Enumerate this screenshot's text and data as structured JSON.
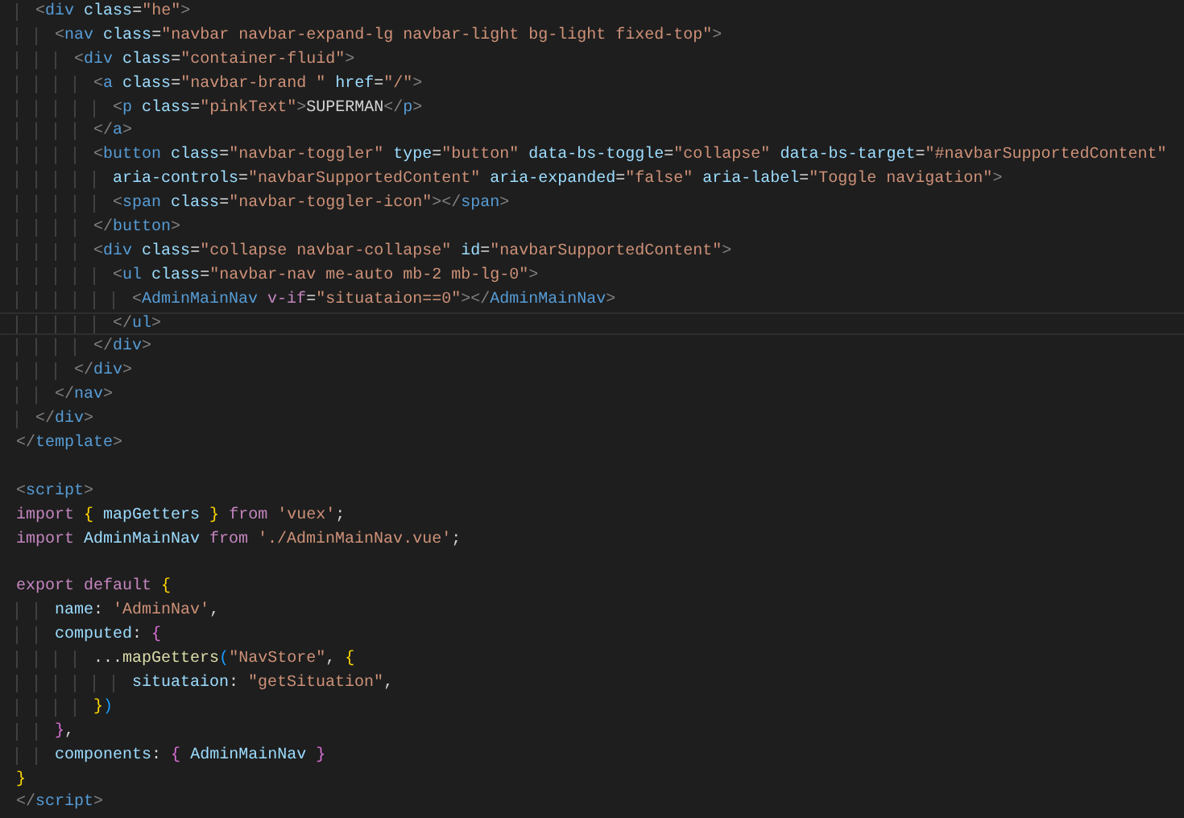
{
  "editor": {
    "lines": [
      {
        "current": false,
        "tokens": [
          {
            "kind": "punct",
            "text": "  <"
          },
          {
            "kind": "tag",
            "text": "div"
          },
          {
            "kind": "attr",
            "text": " class"
          },
          {
            "kind": "text",
            "text": "="
          },
          {
            "kind": "str",
            "text": "\"he\""
          },
          {
            "kind": "punct",
            "text": ">"
          }
        ]
      },
      {
        "current": false,
        "tokens": [
          {
            "kind": "punct",
            "text": "    <"
          },
          {
            "kind": "tag",
            "text": "nav"
          },
          {
            "kind": "attr",
            "text": " class"
          },
          {
            "kind": "text",
            "text": "="
          },
          {
            "kind": "str",
            "text": "\"navbar navbar-expand-lg navbar-light bg-light fixed-top\""
          },
          {
            "kind": "punct",
            "text": ">"
          }
        ]
      },
      {
        "current": false,
        "tokens": [
          {
            "kind": "punct",
            "text": "      <"
          },
          {
            "kind": "tag",
            "text": "div"
          },
          {
            "kind": "attr",
            "text": " class"
          },
          {
            "kind": "text",
            "text": "="
          },
          {
            "kind": "str",
            "text": "\"container-fluid\""
          },
          {
            "kind": "punct",
            "text": ">"
          }
        ]
      },
      {
        "current": false,
        "tokens": [
          {
            "kind": "punct",
            "text": "        <"
          },
          {
            "kind": "tag",
            "text": "a"
          },
          {
            "kind": "attr",
            "text": " class"
          },
          {
            "kind": "text",
            "text": "="
          },
          {
            "kind": "str",
            "text": "\"navbar-brand \""
          },
          {
            "kind": "attr",
            "text": " href"
          },
          {
            "kind": "text",
            "text": "="
          },
          {
            "kind": "str",
            "text": "\"/\""
          },
          {
            "kind": "punct",
            "text": ">"
          }
        ]
      },
      {
        "current": false,
        "tokens": [
          {
            "kind": "punct",
            "text": "          <"
          },
          {
            "kind": "tag",
            "text": "p"
          },
          {
            "kind": "attr",
            "text": " class"
          },
          {
            "kind": "text",
            "text": "="
          },
          {
            "kind": "str",
            "text": "\"pinkText\""
          },
          {
            "kind": "punct",
            "text": ">"
          },
          {
            "kind": "text",
            "text": "SUPERMAN"
          },
          {
            "kind": "punct",
            "text": "</"
          },
          {
            "kind": "tag",
            "text": "p"
          },
          {
            "kind": "punct",
            "text": ">"
          }
        ]
      },
      {
        "current": false,
        "tokens": [
          {
            "kind": "punct",
            "text": "        </"
          },
          {
            "kind": "tag",
            "text": "a"
          },
          {
            "kind": "punct",
            "text": ">"
          }
        ]
      },
      {
        "current": false,
        "tokens": [
          {
            "kind": "punct",
            "text": "        <"
          },
          {
            "kind": "tag",
            "text": "button"
          },
          {
            "kind": "attr",
            "text": " class"
          },
          {
            "kind": "text",
            "text": "="
          },
          {
            "kind": "str",
            "text": "\"navbar-toggler\""
          },
          {
            "kind": "attr",
            "text": " type"
          },
          {
            "kind": "text",
            "text": "="
          },
          {
            "kind": "str",
            "text": "\"button\""
          },
          {
            "kind": "attr",
            "text": " data-bs-toggle"
          },
          {
            "kind": "text",
            "text": "="
          },
          {
            "kind": "str",
            "text": "\"collapse\""
          },
          {
            "kind": "attr",
            "text": " data-bs-target"
          },
          {
            "kind": "text",
            "text": "="
          },
          {
            "kind": "str",
            "text": "\"#navbarSupportedContent\""
          }
        ]
      },
      {
        "current": false,
        "tokens": [
          {
            "kind": "attr",
            "text": "          aria-controls"
          },
          {
            "kind": "text",
            "text": "="
          },
          {
            "kind": "str",
            "text": "\"navbarSupportedContent\""
          },
          {
            "kind": "attr",
            "text": " aria-expanded"
          },
          {
            "kind": "text",
            "text": "="
          },
          {
            "kind": "str",
            "text": "\"false\""
          },
          {
            "kind": "attr",
            "text": " aria-label"
          },
          {
            "kind": "text",
            "text": "="
          },
          {
            "kind": "str",
            "text": "\"Toggle navigation\""
          },
          {
            "kind": "punct",
            "text": ">"
          }
        ]
      },
      {
        "current": false,
        "tokens": [
          {
            "kind": "punct",
            "text": "          <"
          },
          {
            "kind": "tag",
            "text": "span"
          },
          {
            "kind": "attr",
            "text": " class"
          },
          {
            "kind": "text",
            "text": "="
          },
          {
            "kind": "str",
            "text": "\"navbar-toggler-icon\""
          },
          {
            "kind": "punct",
            "text": "></"
          },
          {
            "kind": "tag",
            "text": "span"
          },
          {
            "kind": "punct",
            "text": ">"
          }
        ]
      },
      {
        "current": false,
        "tokens": [
          {
            "kind": "punct",
            "text": "        </"
          },
          {
            "kind": "tag",
            "text": "button"
          },
          {
            "kind": "punct",
            "text": ">"
          }
        ]
      },
      {
        "current": false,
        "tokens": [
          {
            "kind": "punct",
            "text": "        <"
          },
          {
            "kind": "tag",
            "text": "div"
          },
          {
            "kind": "attr",
            "text": " class"
          },
          {
            "kind": "text",
            "text": "="
          },
          {
            "kind": "str",
            "text": "\"collapse navbar-collapse\""
          },
          {
            "kind": "attr",
            "text": " id"
          },
          {
            "kind": "text",
            "text": "="
          },
          {
            "kind": "str",
            "text": "\"navbarSupportedContent\""
          },
          {
            "kind": "punct",
            "text": ">"
          }
        ]
      },
      {
        "current": false,
        "tokens": [
          {
            "kind": "punct",
            "text": "          <"
          },
          {
            "kind": "tag",
            "text": "ul"
          },
          {
            "kind": "attr",
            "text": " class"
          },
          {
            "kind": "text",
            "text": "="
          },
          {
            "kind": "str",
            "text": "\"navbar-nav me-auto mb-2 mb-lg-0\""
          },
          {
            "kind": "punct",
            "text": ">"
          }
        ]
      },
      {
        "current": false,
        "tokens": [
          {
            "kind": "punct",
            "text": "            <"
          },
          {
            "kind": "tag",
            "text": "AdminMainNav"
          },
          {
            "kind": "directive",
            "text": " v-if"
          },
          {
            "kind": "text",
            "text": "="
          },
          {
            "kind": "str",
            "text": "\"situataion==0\""
          },
          {
            "kind": "punct",
            "text": "></"
          },
          {
            "kind": "tag",
            "text": "AdminMainNav"
          },
          {
            "kind": "punct",
            "text": ">"
          }
        ]
      },
      {
        "current": true,
        "tokens": [
          {
            "kind": "punct",
            "text": "          </"
          },
          {
            "kind": "tag",
            "text": "ul"
          },
          {
            "kind": "punct",
            "text": ">"
          }
        ]
      },
      {
        "current": false,
        "tokens": [
          {
            "kind": "punct",
            "text": "        </"
          },
          {
            "kind": "tag",
            "text": "div"
          },
          {
            "kind": "punct",
            "text": ">"
          }
        ]
      },
      {
        "current": false,
        "tokens": [
          {
            "kind": "punct",
            "text": "      </"
          },
          {
            "kind": "tag",
            "text": "div"
          },
          {
            "kind": "punct",
            "text": ">"
          }
        ]
      },
      {
        "current": false,
        "tokens": [
          {
            "kind": "punct",
            "text": "    </"
          },
          {
            "kind": "tag",
            "text": "nav"
          },
          {
            "kind": "punct",
            "text": ">"
          }
        ]
      },
      {
        "current": false,
        "tokens": [
          {
            "kind": "punct",
            "text": "  </"
          },
          {
            "kind": "tag",
            "text": "div"
          },
          {
            "kind": "punct",
            "text": ">"
          }
        ]
      },
      {
        "current": false,
        "tokens": [
          {
            "kind": "punct",
            "text": "</"
          },
          {
            "kind": "tag",
            "text": "template"
          },
          {
            "kind": "punct",
            "text": ">"
          }
        ]
      },
      {
        "kind": "blank"
      },
      {
        "current": false,
        "tokens": [
          {
            "kind": "punct",
            "text": "<"
          },
          {
            "kind": "tag",
            "text": "script"
          },
          {
            "kind": "punct",
            "text": ">"
          }
        ]
      },
      {
        "current": false,
        "tokens": [
          {
            "kind": "kw",
            "text": "import"
          },
          {
            "kind": "brace1",
            "text": " {"
          },
          {
            "kind": "var",
            "text": " mapGetters "
          },
          {
            "kind": "brace1",
            "text": "}"
          },
          {
            "kind": "kw",
            "text": " from"
          },
          {
            "kind": "str",
            "text": " 'vuex'"
          },
          {
            "kind": "text",
            "text": ";"
          }
        ]
      },
      {
        "current": false,
        "tokens": [
          {
            "kind": "kw",
            "text": "import"
          },
          {
            "kind": "var",
            "text": " AdminMainNav"
          },
          {
            "kind": "kw",
            "text": " from"
          },
          {
            "kind": "str",
            "text": " './AdminMainNav.vue'"
          },
          {
            "kind": "text",
            "text": ";"
          }
        ]
      },
      {
        "kind": "blank"
      },
      {
        "current": false,
        "tokens": [
          {
            "kind": "kw",
            "text": "export"
          },
          {
            "kind": "kw",
            "text": " default"
          },
          {
            "kind": "brace1",
            "text": " {"
          }
        ]
      },
      {
        "current": false,
        "tokens": [
          {
            "kind": "var",
            "text": "    name"
          },
          {
            "kind": "text",
            "text": ": "
          },
          {
            "kind": "str",
            "text": "'AdminNav'"
          },
          {
            "kind": "text",
            "text": ","
          }
        ]
      },
      {
        "current": false,
        "tokens": [
          {
            "kind": "var",
            "text": "    computed"
          },
          {
            "kind": "text",
            "text": ": "
          },
          {
            "kind": "brace2",
            "text": "{"
          }
        ]
      },
      {
        "current": false,
        "tokens": [
          {
            "kind": "text",
            "text": "        ..."
          },
          {
            "kind": "fn",
            "text": "mapGetters"
          },
          {
            "kind": "brace3",
            "text": "("
          },
          {
            "kind": "str",
            "text": "\"NavStore\""
          },
          {
            "kind": "text",
            "text": ", "
          },
          {
            "kind": "brace1",
            "text": "{"
          }
        ]
      },
      {
        "current": false,
        "tokens": [
          {
            "kind": "var",
            "text": "            situataion"
          },
          {
            "kind": "text",
            "text": ": "
          },
          {
            "kind": "str",
            "text": "\"getSituation\""
          },
          {
            "kind": "text",
            "text": ","
          }
        ]
      },
      {
        "current": false,
        "tokens": [
          {
            "kind": "brace1",
            "text": "        }"
          },
          {
            "kind": "brace3",
            "text": ")"
          }
        ]
      },
      {
        "current": false,
        "tokens": [
          {
            "kind": "brace2",
            "text": "    }"
          },
          {
            "kind": "text",
            "text": ","
          }
        ]
      },
      {
        "current": false,
        "tokens": [
          {
            "kind": "var",
            "text": "    components"
          },
          {
            "kind": "text",
            "text": ": "
          },
          {
            "kind": "brace2",
            "text": "{"
          },
          {
            "kind": "var",
            "text": " AdminMainNav "
          },
          {
            "kind": "brace2",
            "text": "}"
          }
        ]
      },
      {
        "current": false,
        "tokens": [
          {
            "kind": "brace1",
            "text": "}"
          }
        ]
      },
      {
        "current": false,
        "tokens": [
          {
            "kind": "punct",
            "text": "</"
          },
          {
            "kind": "tag",
            "text": "script"
          },
          {
            "kind": "punct",
            "text": ">"
          }
        ]
      }
    ]
  }
}
